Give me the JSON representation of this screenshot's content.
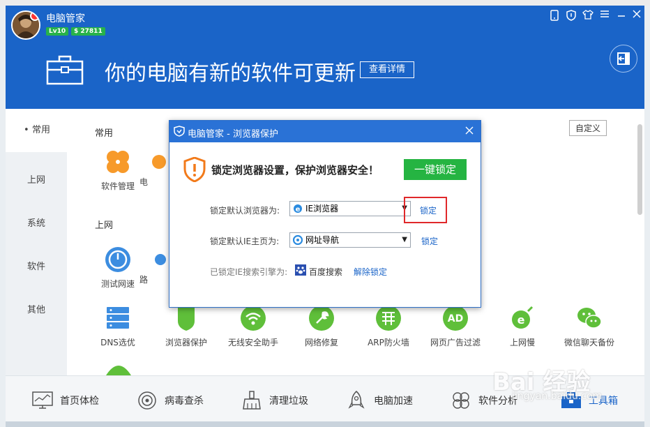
{
  "header": {
    "app_name": "电脑管家",
    "level": "Lv10",
    "coins": "$ 27811",
    "headline": "你的电脑有新的软件可更新",
    "detail_button": "查看详情"
  },
  "tabs": [
    {
      "label": "常用",
      "active": true
    },
    {
      "label": "上网",
      "active": false
    },
    {
      "label": "系统",
      "active": false
    },
    {
      "label": "软件",
      "active": false
    },
    {
      "label": "其他",
      "active": false
    }
  ],
  "content": {
    "customize_label": "自定义",
    "section_common": "常用",
    "section_internet": "上网",
    "common_tools": [
      {
        "label": "软件管理",
        "icon": "clover-icon"
      },
      {
        "label": "电",
        "icon": "partial-icon"
      }
    ],
    "internet_tools_row1": [
      {
        "label": "测试网速",
        "icon": "speedometer-icon"
      },
      {
        "label": "路",
        "icon": "router-icon"
      }
    ],
    "internet_tools_row2": [
      {
        "label": "DNS选优",
        "icon": "server-icon"
      },
      {
        "label": "浏览器保护",
        "icon": "shield-icon"
      },
      {
        "label": "无线安全助手",
        "icon": "wifi-icon"
      },
      {
        "label": "网络修复",
        "icon": "wrench-icon"
      },
      {
        "label": "ARP防火墙",
        "icon": "firewall-icon"
      },
      {
        "label": "网页广告过滤",
        "icon": "adblock-icon"
      },
      {
        "label": "上网慢",
        "icon": "ie-slow-icon"
      },
      {
        "label": "微信聊天备份",
        "icon": "wechat-icon"
      }
    ]
  },
  "bottom_nav": [
    {
      "label": "首页体检",
      "icon": "monitor-icon"
    },
    {
      "label": "病毒查杀",
      "icon": "target-icon"
    },
    {
      "label": "清理垃圾",
      "icon": "broom-icon"
    },
    {
      "label": "电脑加速",
      "icon": "rocket-icon"
    },
    {
      "label": "软件分析",
      "icon": "clover-outline-icon"
    },
    {
      "label": "工具箱",
      "icon": "toolbox-icon"
    }
  ],
  "dialog": {
    "title": "电脑管家 - 浏览器保护",
    "message": "锁定浏览器设置，保护浏览器安全！",
    "lock_all_button": "一键锁定",
    "row1_label": "锁定默认浏览器为:",
    "row1_value": "IE浏览器",
    "row1_action": "锁定",
    "row2_label": "锁定默认IE主页为:",
    "row2_value": "网址导航",
    "row2_action": "锁定",
    "row3_label": "已锁定IE搜索引擎为:",
    "row3_value": "百度搜索",
    "row3_action": "解除锁定"
  },
  "watermark": {
    "main": "Bai 经验",
    "sub": "jingyan.baidu.com"
  },
  "colors": {
    "brand_blue": "#1a64c8",
    "green": "#25b442",
    "orange": "#f79a2a",
    "highlight_red": "#e0282a"
  }
}
